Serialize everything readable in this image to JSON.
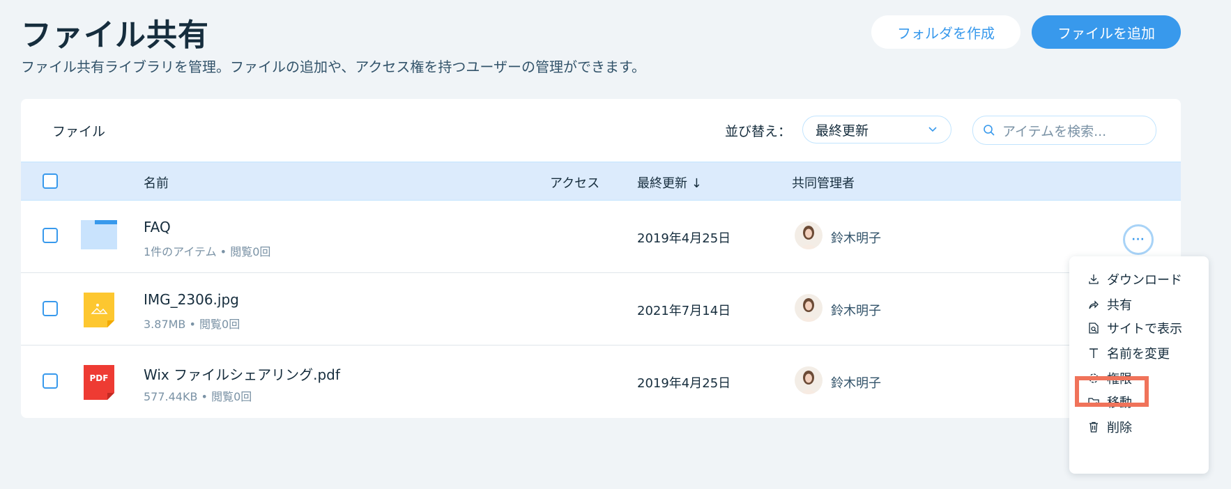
{
  "header": {
    "title": "ファイル共有",
    "subtitle": "ファイル共有ライブラリを管理。ファイルの追加や、アクセス権を持つユーザーの管理ができます。",
    "create_folder_label": "フォルダを作成",
    "add_file_label": "ファイルを追加"
  },
  "toolbar": {
    "title": "ファイル",
    "sort_label": "並び替え：",
    "sort_value": "最終更新",
    "search_placeholder": "アイテムを検索..."
  },
  "table": {
    "columns": {
      "name": "名前",
      "access": "アクセス",
      "updated": "最終更新 ↓",
      "comanagers": "共同管理者"
    },
    "rows": [
      {
        "name": "FAQ",
        "size": "1件のアイテム",
        "views": "閲覧0回",
        "date": "2019年4月25日",
        "manager": "鈴木明子",
        "icon": "folder-icon"
      },
      {
        "name": "IMG_2306.jpg",
        "size": "3.87MB",
        "views": "閲覧0回",
        "date": "2021年7月14日",
        "manager": "鈴木明子",
        "icon": "image-file-icon"
      },
      {
        "name": "Wix ファイルシェアリング.pdf",
        "size": "577.44KB",
        "views": "閲覧0回",
        "date": "2019年4月25日",
        "manager": "鈴木明子",
        "icon": "pdf-file-icon",
        "icon_text": "PDF"
      }
    ]
  },
  "more_button": {
    "label": "···"
  },
  "context_menu": {
    "items": [
      {
        "label": "ダウンロード",
        "icon": "download-icon"
      },
      {
        "label": "共有",
        "icon": "share-icon"
      },
      {
        "label": "サイトで表示",
        "icon": "view-on-site-icon"
      },
      {
        "label": "名前を変更",
        "icon": "rename-icon"
      },
      {
        "label": "権限",
        "icon": "gear-icon",
        "highlighted": true
      },
      {
        "label": "移動",
        "icon": "move-folder-icon"
      },
      {
        "label": "削除",
        "icon": "trash-icon"
      }
    ]
  },
  "colors": {
    "accent": "#3899ec",
    "header_row": "#dcebfc",
    "highlight": "#f0735a",
    "background": "#f0f4f7"
  }
}
